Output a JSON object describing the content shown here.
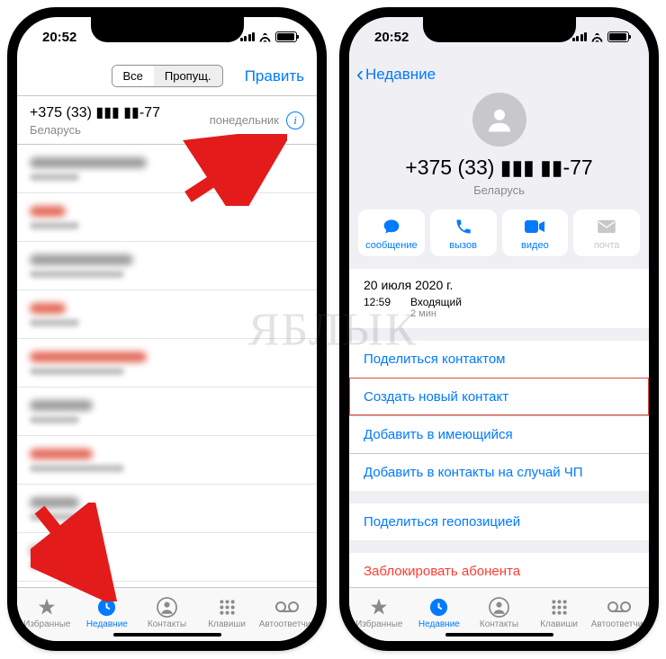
{
  "status": {
    "time": "20:52"
  },
  "p1": {
    "segments": {
      "all": "Все",
      "missed": "Пропущ."
    },
    "edit": "Править",
    "top_call": {
      "number": "+375 (33) ▮▮▮ ▮▮-77",
      "country": "Беларусь",
      "day": "понедельник"
    }
  },
  "p2": {
    "back": "Недавние",
    "contact": {
      "number": "+375 (33) ▮▮▮ ▮▮-77",
      "country": "Беларусь"
    },
    "actions": {
      "message": "сообщение",
      "call": "вызов",
      "video": "видео",
      "mail": "почта"
    },
    "log": {
      "date": "20 июля 2020 г.",
      "time": "12:59",
      "type": "Входящий",
      "duration": "2 мин"
    },
    "links": {
      "share_contact": "Поделиться контактом",
      "create_contact": "Создать новый контакт",
      "add_existing": "Добавить в имеющийся",
      "add_emergency": "Добавить в контакты на случай ЧП",
      "share_location": "Поделиться геопозицией",
      "block": "Заблокировать абонента"
    }
  },
  "tabs": {
    "favorites": "Избранные",
    "recents": "Недавние",
    "contacts": "Контакты",
    "keypad": "Клавиши",
    "voicemail": "Автоответчик"
  },
  "watermark": "ЯБЛЫК"
}
